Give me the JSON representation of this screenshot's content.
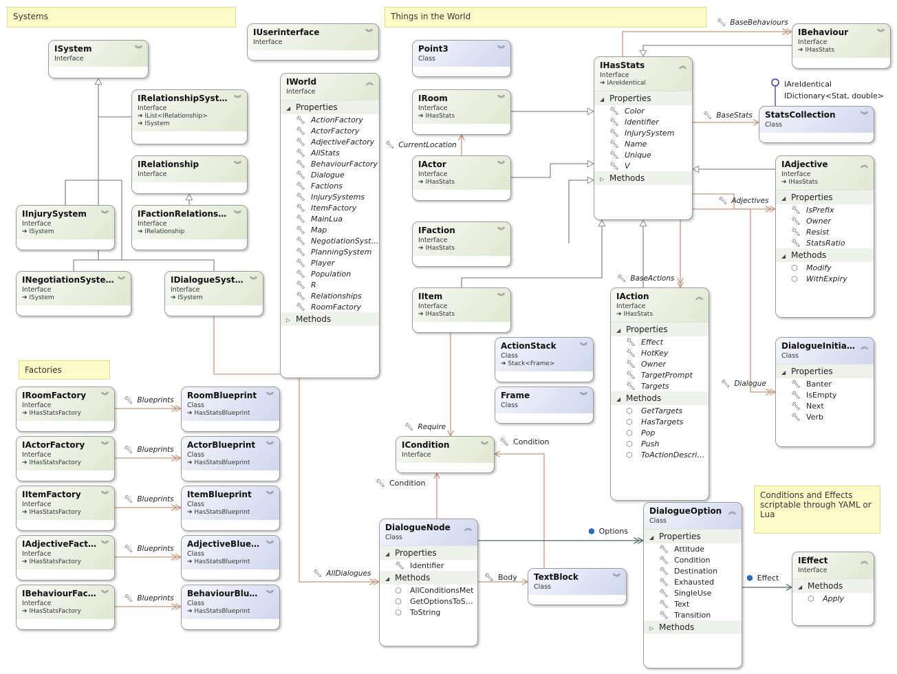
{
  "notes": [
    {
      "id": "systems",
      "text": "Systems"
    },
    {
      "id": "world",
      "text": "Things in the World"
    },
    {
      "id": "factories",
      "text": "Factories"
    },
    {
      "id": "conditions",
      "text": "Conditions and Effects scriptable through YAML or Lua"
    }
  ],
  "boxes": [
    {
      "id": "ISystem",
      "name": "ISystem",
      "kind": "Interface",
      "inherits": []
    },
    {
      "id": "IRelationshipSystem",
      "name": "IRelationshipSystem",
      "kind": "Interface",
      "inherits": [
        "IList<IRelationship>",
        "ISystem"
      ]
    },
    {
      "id": "IRelationship",
      "name": "IRelationship",
      "kind": "Interface",
      "inherits": []
    },
    {
      "id": "IInjurySystem",
      "name": "IInjurySystem",
      "kind": "Interface",
      "inherits": [
        "ISystem"
      ]
    },
    {
      "id": "IFactionRelationship",
      "name": "IFactionRelationship",
      "kind": "Interface",
      "inherits": [
        "IRelationship"
      ]
    },
    {
      "id": "INegotiationSystem",
      "name": "INegotiationSystem",
      "kind": "Interface",
      "inherits": [
        "ISystem"
      ]
    },
    {
      "id": "IDialogueSystem",
      "name": "IDialogueSystem",
      "kind": "Interface",
      "inherits": [
        "ISystem"
      ]
    },
    {
      "id": "IUserinterface",
      "name": "IUserinterface",
      "kind": "Interface",
      "inherits": []
    },
    {
      "id": "IWorld",
      "name": "IWorld",
      "kind": "Interface",
      "inherits": [],
      "italic": true,
      "sections": [
        {
          "label": "Properties",
          "expanded": true,
          "type": "p",
          "items": [
            "ActionFactory",
            "ActorFactory",
            "AdjectiveFactory",
            "AllStats",
            "BehaviourFactory",
            "Dialogue",
            "Factions",
            "InjurySystems",
            "ItemFactory",
            "MainLua",
            "Map",
            "NegotiationSystems",
            "PlanningSystem",
            "Player",
            "Population",
            "R",
            "Relationships",
            "RoomFactory"
          ]
        },
        {
          "label": "Methods",
          "expanded": false,
          "type": "m",
          "items": []
        }
      ]
    },
    {
      "id": "Point3",
      "name": "Point3",
      "kind": "Class",
      "cls": true,
      "inherits": []
    },
    {
      "id": "IRoom",
      "name": "IRoom",
      "kind": "Interface",
      "inherits": [
        "IHasStats"
      ]
    },
    {
      "id": "IActor",
      "name": "IActor",
      "kind": "Interface",
      "inherits": [
        "IHasStats"
      ]
    },
    {
      "id": "IFaction",
      "name": "IFaction",
      "kind": "Interface",
      "inherits": [
        "IHasStats"
      ]
    },
    {
      "id": "IItem",
      "name": "IItem",
      "kind": "Interface",
      "inherits": [
        "IHasStats"
      ]
    },
    {
      "id": "ActionStack",
      "name": "ActionStack",
      "kind": "Class",
      "cls": true,
      "inherits": [
        "Stack<Frame>"
      ]
    },
    {
      "id": "Frame",
      "name": "Frame",
      "kind": "Class",
      "cls": true,
      "inherits": []
    },
    {
      "id": "IHasStats",
      "name": "IHasStats",
      "kind": "Interface",
      "inherits": [
        "IAreIdentical"
      ],
      "italic": true,
      "sections": [
        {
          "label": "Properties",
          "expanded": true,
          "type": "p",
          "items": [
            "Color",
            "Identifier",
            "InjurySystem",
            "Name",
            "Unique",
            "V"
          ]
        },
        {
          "label": "Methods",
          "expanded": false,
          "type": "m",
          "items": []
        }
      ]
    },
    {
      "id": "IBehaviour",
      "name": "IBehaviour",
      "kind": "Interface",
      "inherits": [
        "IHasStats"
      ]
    },
    {
      "id": "StatsCollection",
      "name": "StatsCollection",
      "kind": "Class",
      "cls": true,
      "inherits": []
    },
    {
      "id": "IAdjective",
      "name": "IAdjective",
      "kind": "Interface",
      "inherits": [
        "IHasStats"
      ],
      "italic": true,
      "sections": [
        {
          "label": "Properties",
          "expanded": true,
          "type": "p",
          "items": [
            "IsPrefix",
            "Owner",
            "Resist",
            "StatsRatio"
          ]
        },
        {
          "label": "Methods",
          "expanded": true,
          "type": "m",
          "items": [
            "Modify",
            "WithExpiry"
          ]
        }
      ]
    },
    {
      "id": "IAction",
      "name": "IAction",
      "kind": "Interface",
      "inherits": [
        "IHasStats"
      ],
      "italic": true,
      "sections": [
        {
          "label": "Properties",
          "expanded": true,
          "type": "p",
          "items": [
            "Effect",
            "HotKey",
            "Owner",
            "TargetPrompt",
            "Targets"
          ]
        },
        {
          "label": "Methods",
          "expanded": true,
          "type": "m",
          "items": [
            "GetTargets",
            "HasTargets",
            "Pop",
            "Push",
            "ToActionDescription"
          ]
        }
      ]
    },
    {
      "id": "DialogueInitiation",
      "name": "DialogueInitiation",
      "kind": "Class",
      "cls": true,
      "inherits": [],
      "sections": [
        {
          "label": "Properties",
          "expanded": true,
          "type": "p",
          "items": [
            "Banter",
            "IsEmpty",
            "Next",
            "Verb"
          ]
        }
      ]
    },
    {
      "id": "ICondition",
      "name": "ICondition",
      "kind": "Interface",
      "inherits": []
    },
    {
      "id": "DialogueNode",
      "name": "DialogueNode",
      "kind": "Class",
      "cls": true,
      "inherits": [],
      "sections": [
        {
          "label": "Properties",
          "expanded": true,
          "type": "p",
          "items": [
            "Identifier"
          ]
        },
        {
          "label": "Methods",
          "expanded": true,
          "type": "m",
          "items": [
            "AllConditionsMet",
            "GetOptionsToShow",
            "ToString"
          ]
        }
      ]
    },
    {
      "id": "TextBlock",
      "name": "TextBlock",
      "kind": "Class",
      "cls": true,
      "inherits": []
    },
    {
      "id": "DialogueOption",
      "name": "DialogueOption",
      "kind": "Class",
      "cls": true,
      "inherits": [],
      "sections": [
        {
          "label": "Properties",
          "expanded": true,
          "type": "p",
          "items": [
            "Attitude",
            "Condition",
            "Destination",
            "Exhausted",
            "SingleUse",
            "Text",
            "Transition"
          ]
        },
        {
          "label": "Methods",
          "expanded": false,
          "type": "m",
          "items": []
        }
      ]
    },
    {
      "id": "IEffect",
      "name": "IEffect",
      "kind": "Interface",
      "inherits": [],
      "italic": true,
      "sections": [
        {
          "label": "Methods",
          "expanded": true,
          "type": "m",
          "items": [
            "Apply"
          ]
        }
      ]
    },
    {
      "id": "IRoomFactory",
      "name": "IRoomFactory",
      "kind": "Interface",
      "inherits": [
        "IHasStatsFactory"
      ]
    },
    {
      "id": "IActorFactory",
      "name": "IActorFactory",
      "kind": "Interface",
      "inherits": [
        "IHasStatsFactory"
      ]
    },
    {
      "id": "IItemFactory",
      "name": "IItemFactory",
      "kind": "Interface",
      "inherits": [
        "IHasStatsFactory"
      ]
    },
    {
      "id": "IAdjectiveFactory",
      "name": "IAdjectiveFactory",
      "kind": "Interface",
      "inherits": [
        "IHasStatsFactory"
      ]
    },
    {
      "id": "IBehaviourFactory",
      "name": "IBehaviourFactory",
      "kind": "Interface",
      "inherits": [
        "IHasStatsFactory"
      ]
    },
    {
      "id": "RoomBlueprint",
      "name": "RoomBlueprint",
      "kind": "Class",
      "cls": true,
      "inherits": [
        "HasStatsBlueprint"
      ]
    },
    {
      "id": "ActorBlueprint",
      "name": "ActorBlueprint",
      "kind": "Class",
      "cls": true,
      "inherits": [
        "HasStatsBlueprint"
      ]
    },
    {
      "id": "ItemBlueprint",
      "name": "ItemBlueprint",
      "kind": "Class",
      "cls": true,
      "inherits": [
        "HasStatsBlueprint"
      ]
    },
    {
      "id": "AdjectiveBlueprint",
      "name": "AdjectiveBlueprint",
      "kind": "Class",
      "cls": true,
      "inherits": [
        "HasStatsBlueprint"
      ]
    },
    {
      "id": "BehaviourBlueprint",
      "name": "BehaviourBlueprint",
      "kind": "Class",
      "cls": true,
      "inherits": [
        "HasStatsBlueprint"
      ]
    }
  ],
  "labels": [
    {
      "id": "BaseBehaviours",
      "text": "BaseBehaviours",
      "italic": true,
      "icon": "wrench"
    },
    {
      "id": "BaseStats",
      "text": "BaseStats",
      "italic": true,
      "icon": "wrench"
    },
    {
      "id": "Adjectives",
      "text": "Adjectives",
      "italic": true,
      "icon": "wrench"
    },
    {
      "id": "BaseActions",
      "text": "BaseActions",
      "italic": true,
      "icon": "wrench"
    },
    {
      "id": "CurrentLocation",
      "text": "CurrentLocation",
      "italic": true,
      "icon": "wrench"
    },
    {
      "id": "Require",
      "text": "Require",
      "italic": true,
      "icon": "wrench"
    },
    {
      "id": "AllDialogues",
      "text": "AllDialogues",
      "italic": true,
      "icon": "wrench"
    },
    {
      "id": "Dialogue",
      "text": "Dialogue",
      "italic": true,
      "icon": "wrench"
    },
    {
      "id": "Condition1",
      "text": "Condition",
      "italic": false,
      "icon": "wrench"
    },
    {
      "id": "Condition2",
      "text": "Condition",
      "italic": false,
      "icon": "wrench"
    },
    {
      "id": "Body",
      "text": "Body",
      "italic": false,
      "icon": "wrench"
    },
    {
      "id": "Options",
      "text": "Options",
      "italic": false,
      "icon": "field"
    },
    {
      "id": "Effect",
      "text": "Effect",
      "italic": false,
      "icon": "field"
    },
    {
      "id": "BP0",
      "text": "Blueprints",
      "italic": true,
      "icon": "wrench"
    },
    {
      "id": "BP1",
      "text": "Blueprints",
      "italic": true,
      "icon": "wrench"
    },
    {
      "id": "BP2",
      "text": "Blueprints",
      "italic": true,
      "icon": "wrench"
    },
    {
      "id": "BP3",
      "text": "Blueprints",
      "italic": true,
      "icon": "wrench"
    },
    {
      "id": "BP4",
      "text": "Blueprints",
      "italic": true,
      "icon": "wrench"
    },
    {
      "id": "Lollipop",
      "text": "IAreIdentical\nIDictionary<Stat, double>",
      "italic": false,
      "icon": "none"
    }
  ],
  "colors": {
    "association": "#c8957a",
    "inheritance": "#8a8a8a",
    "interface_lollipop": "#3a3aa0",
    "options": "#4a6a6a"
  }
}
